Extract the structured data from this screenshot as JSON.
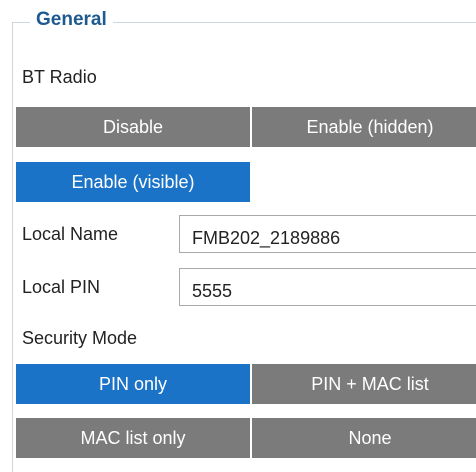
{
  "general": {
    "legend": "General"
  },
  "bt_radio": {
    "label": "BT Radio",
    "options": [
      "Disable",
      "Enable (hidden)",
      "Enable (visible)"
    ],
    "selected": "Enable (visible)"
  },
  "local_name": {
    "label": "Local Name",
    "value": "FMB202_2189886"
  },
  "local_pin": {
    "label": "Local PIN",
    "value": "5555"
  },
  "security_mode": {
    "label": "Security Mode",
    "options": [
      "PIN only",
      "PIN + MAC list",
      "MAC list only",
      "None"
    ],
    "selected": "PIN only"
  },
  "colors": {
    "active": "#1a73c7",
    "inactive": "#7b7b7b",
    "legend": "#1e5a8f"
  }
}
